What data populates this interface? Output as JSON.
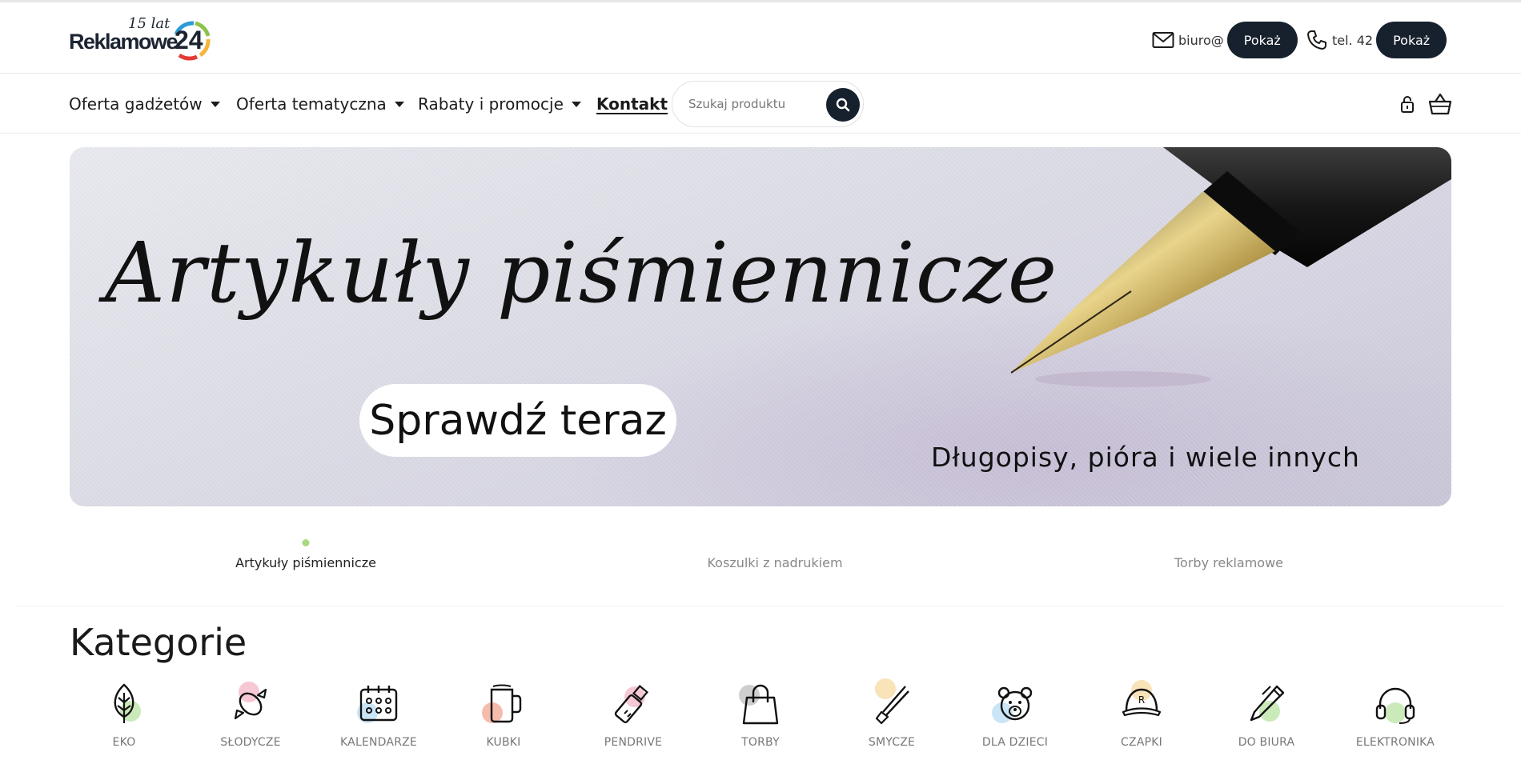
{
  "header": {
    "logo": {
      "years": "15 lat",
      "brand": "Reklamowe",
      "number": "24"
    },
    "email": {
      "text": "biuro@",
      "button": "Pokaż",
      "icon": "mail-icon"
    },
    "phone": {
      "text": "tel. 42",
      "button": "Pokaż",
      "icon": "phone-icon"
    }
  },
  "nav": {
    "items": [
      {
        "label": "Oferta gadżetów",
        "dropdown": true
      },
      {
        "label": "Oferta tematyczna",
        "dropdown": true
      },
      {
        "label": "Rabaty i promocje",
        "dropdown": true
      },
      {
        "label": "Kontakt",
        "dropdown": false
      }
    ],
    "search": {
      "placeholder": "Szukaj produktu",
      "value": ""
    },
    "icons": [
      "lock-icon",
      "basket-icon"
    ]
  },
  "hero": {
    "title": "Artykuły piśmiennicze",
    "cta": "Sprawdź teraz",
    "subtitle": "Długopisy, pióra i wiele innych"
  },
  "slider": {
    "items": [
      "Artykuły piśmiennicze",
      "Koszulki z nadrukiem",
      "Torby reklamowe"
    ],
    "active": 0,
    "dot_color": "#a8d97f"
  },
  "categories": {
    "heading": "Kategorie",
    "items": [
      {
        "label": "EKO",
        "icon": "leaf-icon",
        "accent": "#b9e3a3"
      },
      {
        "label": "SŁODYCZE",
        "icon": "candy-icon",
        "accent": "#f3b6c4"
      },
      {
        "label": "KALENDARZE",
        "icon": "calendar-icon",
        "accent": "#b8dcf2"
      },
      {
        "label": "KUBKI",
        "icon": "mug-icon",
        "accent": "#f2a58f"
      },
      {
        "label": "PENDRIVE",
        "icon": "pendrive-icon",
        "accent": "#f3b6c4"
      },
      {
        "label": "TORBY",
        "icon": "bag-icon",
        "accent": "#bdbdbd"
      },
      {
        "label": "SMYCZE",
        "icon": "lanyard-icon",
        "accent": "#f7d9a0"
      },
      {
        "label": "DLA DZIECI",
        "icon": "teddy-bear-icon",
        "accent": "#b8dcf2"
      },
      {
        "label": "CZAPKI",
        "icon": "cap-icon",
        "accent": "#f7d9a0"
      },
      {
        "label": "DO BIURA",
        "icon": "pen-icon",
        "accent": "#b9e3a3"
      },
      {
        "label": "ELEKTRONIKA",
        "icon": "headphones-icon",
        "accent": "#b9e3a3"
      }
    ]
  },
  "colors": {
    "dark": "#17202d",
    "accent_green": "#a8d97f"
  }
}
